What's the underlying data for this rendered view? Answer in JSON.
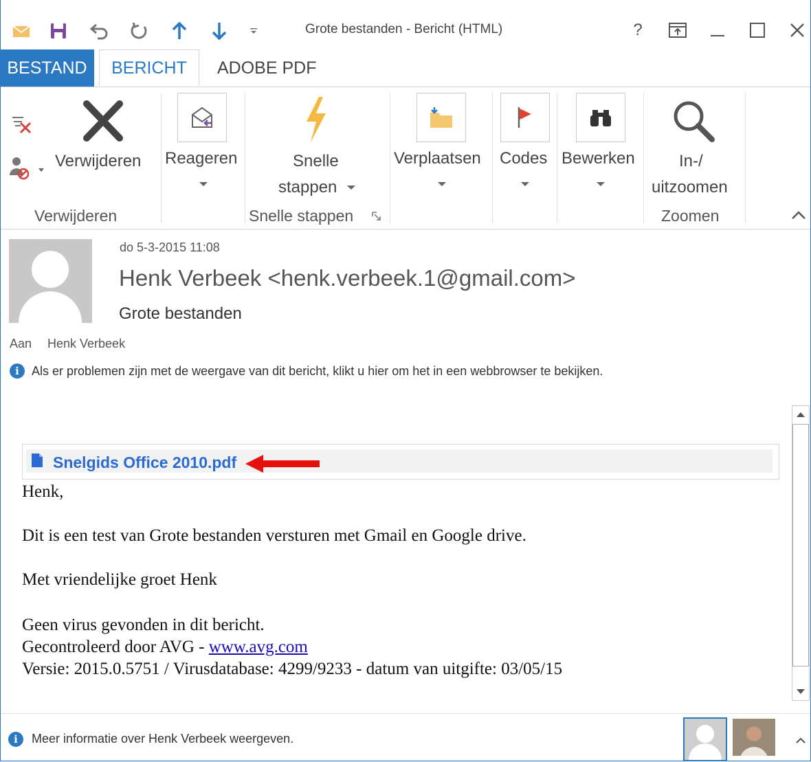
{
  "window": {
    "title": "Grote bestanden - Bericht (HTML)",
    "help": "?",
    "accent": "#2b79c2"
  },
  "tabs": [
    "BESTAND",
    "BERICHT",
    "ADOBE PDF"
  ],
  "ribbon": {
    "delete_label": "Verwijderen",
    "reply_label": "Reageren",
    "quicksteps_label_1": "Snelle",
    "quicksteps_label_2": "stappen",
    "move_label": "Verplaatsen",
    "tags_label": "Codes",
    "edit_label": "Bewerken",
    "zoom_label_1": "In-/",
    "zoom_label_2": "uitzoomen",
    "groups": {
      "delete": "Verwijderen",
      "quicksteps": "Snelle stappen",
      "zoom": "Zoomen"
    }
  },
  "message": {
    "date": "do 5-3-2015 11:08",
    "sender": "Henk Verbeek <henk.verbeek.1@gmail.com>",
    "subject": "Grote bestanden",
    "to_label": "Aan",
    "to_value": "Henk Verbeek",
    "info_text": "Als er problemen zijn met de weergave van dit bericht, klikt u hier om het in een webbrowser te bekijken.",
    "attachment": "Snelgids Office 2010.pdf",
    "body": {
      "greeting": "Henk,",
      "line1": "Dit is een test van Grote bestanden versturen met Gmail en Google drive.",
      "line2": "Met vriendelijke groet Henk",
      "line3": "Geen virus gevonden in dit bericht.",
      "line4_prefix": "Gecontroleerd door AVG - ",
      "line4_link": "www.avg.com",
      "line5": "Versie: 2015.0.5751 / Virusdatabase: 4299/9233 - datum van uitgifte: 03/05/15"
    }
  },
  "footer": {
    "info_text": "Meer informatie over Henk Verbeek weergeven."
  }
}
